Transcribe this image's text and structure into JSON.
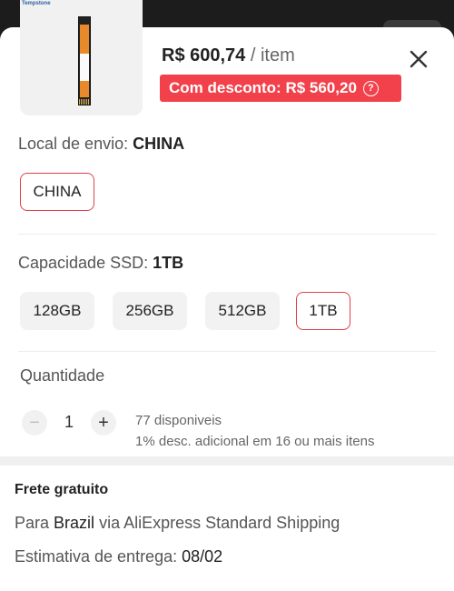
{
  "product": {
    "brand_text": "Tempstone",
    "price": "R$ 600,74",
    "price_unit": "/ item",
    "discount_label": "Com desconto: R$ 560,20",
    "info_glyph": "?"
  },
  "shipping_from": {
    "label": "Local de envio:",
    "selected": "CHINA",
    "options": [
      "CHINA"
    ]
  },
  "capacity": {
    "label": "Capacidade SSD:",
    "selected": "1TB",
    "options": [
      "128GB",
      "256GB",
      "512GB",
      "1TB"
    ]
  },
  "quantity": {
    "label": "Quantidade",
    "minus": "−",
    "value": "1",
    "plus": "+",
    "available": "77 disponiveis",
    "bulk_discount": "1% desc. adicional em 16 ou mais itens"
  },
  "shipping": {
    "title": "Frete gratuito",
    "to_prefix": "Para",
    "country": "Brazil",
    "via": "via AliExpress Standard Shipping",
    "estimate_label": "Estimativa de entrega:",
    "estimate_date": "08/02"
  },
  "colors": {
    "accent": "#f2414b",
    "selected_border": "#e0404a"
  }
}
